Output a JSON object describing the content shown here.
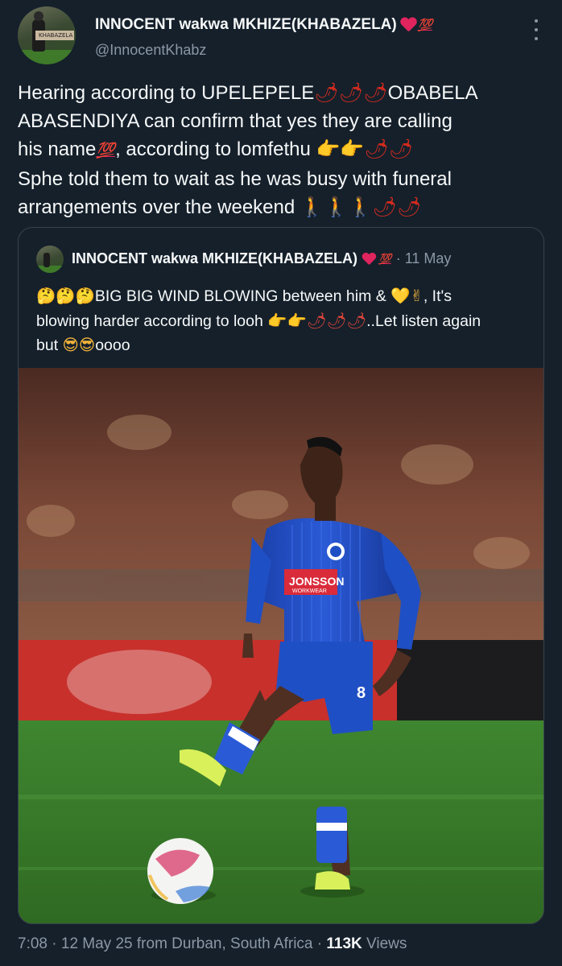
{
  "tweet": {
    "author": {
      "name": "INNOCENT wakwa MKHIZE(KHABAZELA)",
      "name_suffix": "💯",
      "handle": "@InnocentKhabz",
      "avatar_text": "KHABAZELA"
    },
    "body": {
      "line1": "Hearing according to UPELEPELE",
      "chilis1": "🌶🌶🌶",
      "line1b": "OBABELA",
      "line2": "ABASENDIYA can confirm that yes they are calling",
      "line3a": "his name",
      "line3_100": "💯",
      "line3b": ", according to lomfethu",
      "line3_points": "👉👉",
      "line3_chilis": "🌶🌶",
      "line4": "Sphe told them to wait as he was busy with funeral",
      "line5": "arrangements over the weekend",
      "line5_walkers": "🚶🚶🚶",
      "line5_chilis": "🌶🌶"
    },
    "quote": {
      "name": "INNOCENT wakwa MKHIZE(KHABAZELA)",
      "name_suffix": "💯",
      "date": "· 11 May",
      "text_emoji1": "🤔🤔🤔",
      "text1": "BIG BIG WIND BLOWING between him &",
      "text_emoji2": "💛✌",
      "text2": ", It's",
      "text3": "blowing harder according to looh",
      "text_emoji3": "👉👉🌶🌶🌶",
      "text4": "..Let listen again",
      "text5": "but",
      "text_emoji4": "😎😎",
      "text6": "oooo",
      "photo": {
        "sponsor_line1": "JONSSON",
        "sponsor_line2": "WORKWEAR",
        "shirt_number": "8"
      }
    },
    "meta": {
      "time": "7:08",
      "date": "12 May 25",
      "location_prefix": "from Durban, South Africa",
      "views_count": "113K",
      "views_label": "Views"
    }
  },
  "colors": {
    "background": "#15202b",
    "text_primary": "#f7f9f9",
    "text_secondary": "#8b98a5",
    "border": "#38444d",
    "kit_blue": "#1f4fc4",
    "pitch_green": "#3e7f2c"
  },
  "icons": [
    "more-options-icon",
    "heart-emoji-icon",
    "hundred-emoji-icon",
    "chili-emoji-icon",
    "point-right-emoji-icon",
    "walking-emoji-icon"
  ]
}
